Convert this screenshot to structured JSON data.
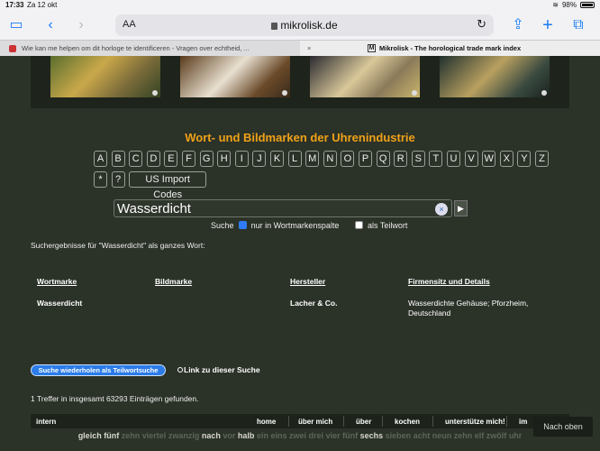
{
  "status": {
    "time": "17:33",
    "date": "Za 12 okt",
    "battery": "98%"
  },
  "browser": {
    "aa_label": "AA",
    "url": "mikrolisk.de",
    "tabs": [
      {
        "title": "Wie kan me helpen om dit horloge te identificeren - Vragen over echtheid, ..."
      },
      {
        "title": "Mikrolisk - The horological trade mark index",
        "favicon_letter": "M"
      }
    ]
  },
  "page": {
    "heading": "Wort- und Bildmarken der Uhrenindustrie",
    "letters": [
      "A",
      "B",
      "C",
      "D",
      "E",
      "F",
      "G",
      "H",
      "I",
      "J",
      "K",
      "L",
      "M",
      "N",
      "O",
      "P",
      "Q",
      "R",
      "S",
      "T",
      "U",
      "V",
      "W",
      "X",
      "Y",
      "Z"
    ],
    "extra_keys": [
      "*",
      "?",
      "US Import Codes"
    ],
    "search": {
      "value": "Wasserdicht",
      "clear_symbol": "×",
      "go_symbol": "▶"
    },
    "options": {
      "prefix": "Suche",
      "option1": "nur in Wortmarkenspalte",
      "option1_checked": true,
      "option2": "als Teilwort",
      "option2_checked": false
    },
    "results_note": "Suchergebnisse für \"Wasserdicht\" als ganzes Wort:",
    "table": {
      "headers": [
        "Wortmarke",
        "Bildmarke",
        "Hersteller",
        "Firmensitz und Details"
      ],
      "rows": [
        {
          "wortmarke": "Wasserdicht",
          "bildmarke": "",
          "hersteller": "Lacher & Co.",
          "details": "Wasserdichte Gehäuse; Pforzheim, Deutschland"
        }
      ]
    },
    "repeat_button": "Suche wiederholen als Teilwortsuche",
    "link_label": "Link zu dieser Suche",
    "hits": "1 Treffer in insgesamt 63293 Einträgen gefunden.",
    "nav": {
      "intern": "intern",
      "items": [
        "home",
        "über mich",
        "über",
        "kochen",
        "unterstütze mich!",
        "im"
      ]
    },
    "back_to_top": "Nach oben",
    "clock_words": [
      {
        "w": "gleich",
        "on": true
      },
      {
        "w": "fünf",
        "on": true
      },
      {
        "w": "zehn",
        "on": false
      },
      {
        "w": "viertel",
        "on": false
      },
      {
        "w": "zwanzig",
        "on": false
      },
      {
        "w": "nach",
        "on": true
      },
      {
        "w": "vor",
        "on": false
      },
      {
        "w": "halb",
        "on": true
      },
      {
        "w": "ein",
        "on": false
      },
      {
        "w": "eins",
        "on": false
      },
      {
        "w": "zwei",
        "on": false
      },
      {
        "w": "drei",
        "on": false
      },
      {
        "w": "vier",
        "on": false
      },
      {
        "w": "fünf",
        "on": false
      },
      {
        "w": "sechs",
        "on": true
      },
      {
        "w": "sieben",
        "on": false
      },
      {
        "w": "acht",
        "on": false
      },
      {
        "w": "neun",
        "on": false
      },
      {
        "w": "zehn",
        "on": false
      },
      {
        "w": "elf",
        "on": false
      },
      {
        "w": "zwölf",
        "on": false
      },
      {
        "w": "uhr",
        "on": false
      }
    ]
  }
}
